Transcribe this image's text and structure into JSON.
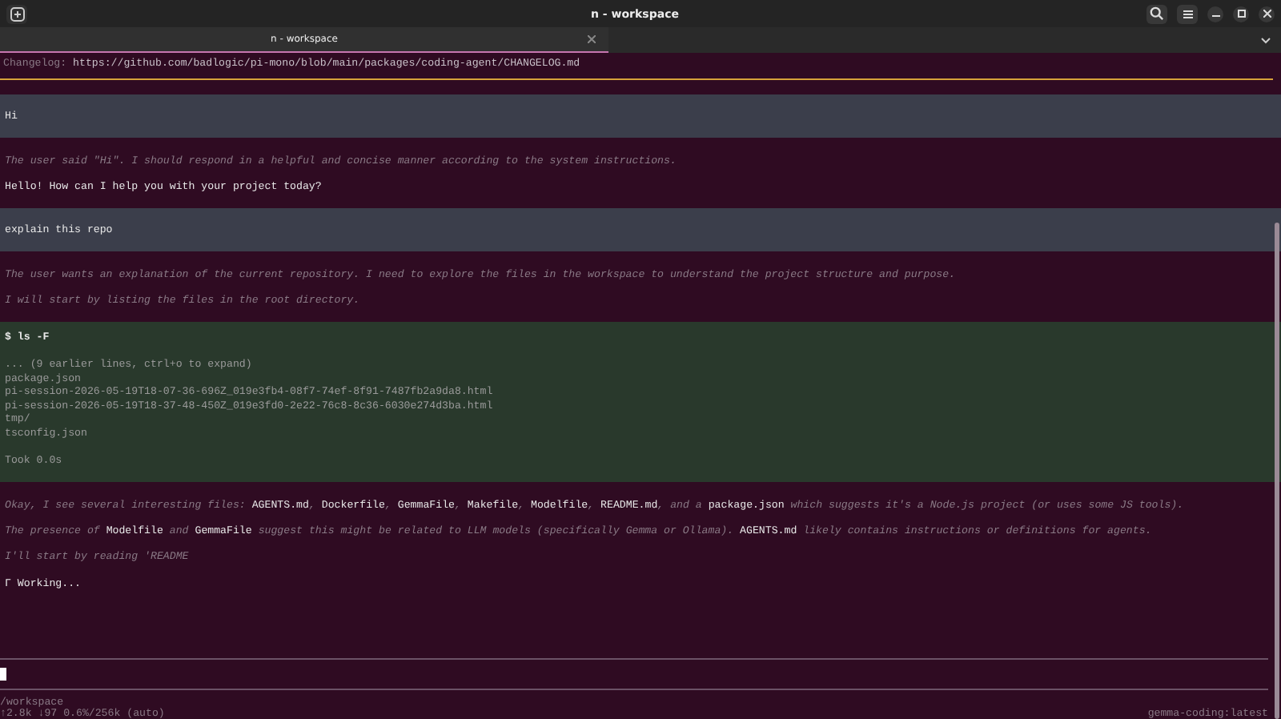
{
  "window": {
    "title": "n - workspace"
  },
  "tabs": [
    {
      "label": "n - workspace",
      "selected": true
    }
  ],
  "changelog": {
    "label": "Changelog:",
    "url": "https://github.com/badlogic/pi-mono/blob/main/packages/coding-agent/CHANGELOG.md"
  },
  "messages": [
    {
      "kind": "user",
      "text": "Hi"
    },
    {
      "kind": "thinking",
      "text": "The user said \"Hi\". I should respond in a helpful and concise manner according to the system instructions."
    },
    {
      "kind": "assistant",
      "text": "Hello! How can I help you with your project today?"
    },
    {
      "kind": "user",
      "text": "explain this repo"
    },
    {
      "kind": "thinking",
      "text": "The user wants an explanation of the current repository. I need to explore the files in the workspace to understand the project structure and purpose."
    },
    {
      "kind": "thinking",
      "text": "I will start by listing the files in the root directory."
    },
    {
      "kind": "tool",
      "command": "$ ls -F",
      "note": "... (9 earlier lines, ctrl+o to expand)",
      "lines": [
        "package.json",
        "pi-session-2026-05-19T18-07-36-696Z_019e3fb4-08f7-74ef-8f91-7487fb2a9da8.html",
        "pi-session-2026-05-19T18-37-48-450Z_019e3fd0-2e22-76c8-8c36-6030e274d3ba.html",
        "tmp/",
        "tsconfig.json"
      ],
      "took": "Took 0.0s"
    },
    {
      "kind": "thinking",
      "text": "Okay, I see several interesting files: **AGENTS.md**, **Dockerfile**, **GemmaFile**, **Makefile**, **Modelfile**, **README.md**, and a **package.json** which suggests it's a Node.js project (or uses some JS tools)."
    },
    {
      "kind": "thinking",
      "text": "The presence of **Modelfile** and **GemmaFile** suggest this might be related to LLM models (specifically Gemma or Ollama). **AGENTS.md** likely contains instructions or definitions for agents."
    },
    {
      "kind": "thinking",
      "text": "I'll start by reading 'README"
    },
    {
      "kind": "status",
      "text": "Γ Working..."
    }
  ],
  "footer": {
    "path": "/workspace",
    "stats": "↑2.8k ↓97 0.6%/256k (auto)",
    "model": "gemma-coding:latest"
  }
}
